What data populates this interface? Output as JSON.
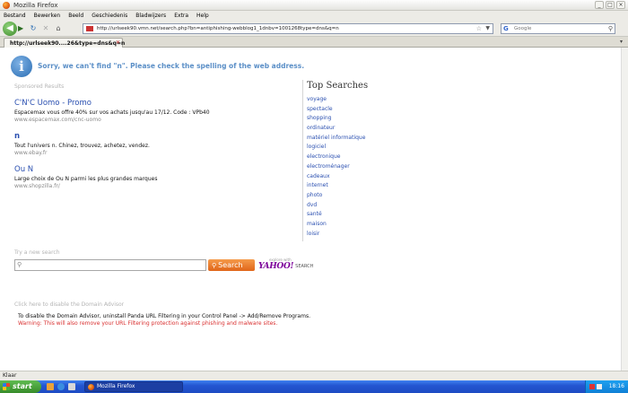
{
  "window": {
    "title": "Mozilla Firefox",
    "controls": [
      "_",
      "□",
      "×"
    ]
  },
  "menu": [
    "Bestand",
    "Bewerken",
    "Beeld",
    "Geschiedenis",
    "Bladwijzers",
    "Extra",
    "Help"
  ],
  "nav": {
    "url": "http://urlseek90.vmn.net/search.php?bn=antiphishing-webblog1_1dnbv=1001268type=dns&q=n",
    "search_placeholder": "Google",
    "search_engine_glyph": "G"
  },
  "tab": {
    "label": "http://urlseek90....26&type=dns&q=n"
  },
  "content": {
    "error_message": "Sorry, we can't find \"n\". Please check the spelling of the web address.",
    "sponsored_label": "Sponsored Results",
    "ads": [
      {
        "title": "C'N'C Uomo - Promo",
        "description": "Espacemax vous offre 40% sur vos achats jusqu'au 17/12. Code : VPb40",
        "url": "www.espacemax.com/cnc-uomo"
      },
      {
        "title": "n",
        "description": "Tout l'univers n. Chinez, trouvez, achetez, vendez.",
        "url": "www.ebay.fr"
      },
      {
        "title": "Ou N",
        "description": "Large choix de Ou N parmi les plus grandes marques",
        "url": "www.shopzilla.fr/"
      }
    ],
    "top_searches_title": "Top Searches",
    "top_searches": [
      "voyage",
      "spectacle",
      "shopping",
      "ordinateur",
      "matériel informatique",
      "logiciel",
      "electronique",
      "electroménager",
      "cadeaux",
      "internet",
      "photo",
      "dvd",
      "santé",
      "maison",
      "loisir"
    ],
    "try_label": "Try a new search",
    "search_button": "Search",
    "yahoo_small": "explore with",
    "yahoo_logo": "YAHOO!",
    "yahoo_search": "SEARCH",
    "disable_link": "Click here to disable the Domain Advisor",
    "advisor_text": "To disable the Domain Advisor, uninstall Panda URL Filtering in your Control Panel -> Add/Remove Programs.",
    "warning_text": "Warning: This will also remove your URL Filtering protection against phishing and malware sites."
  },
  "status": "Klaar",
  "taskbar": {
    "start": "start",
    "task": "Mozilla Firefox",
    "clock": "18:16"
  }
}
